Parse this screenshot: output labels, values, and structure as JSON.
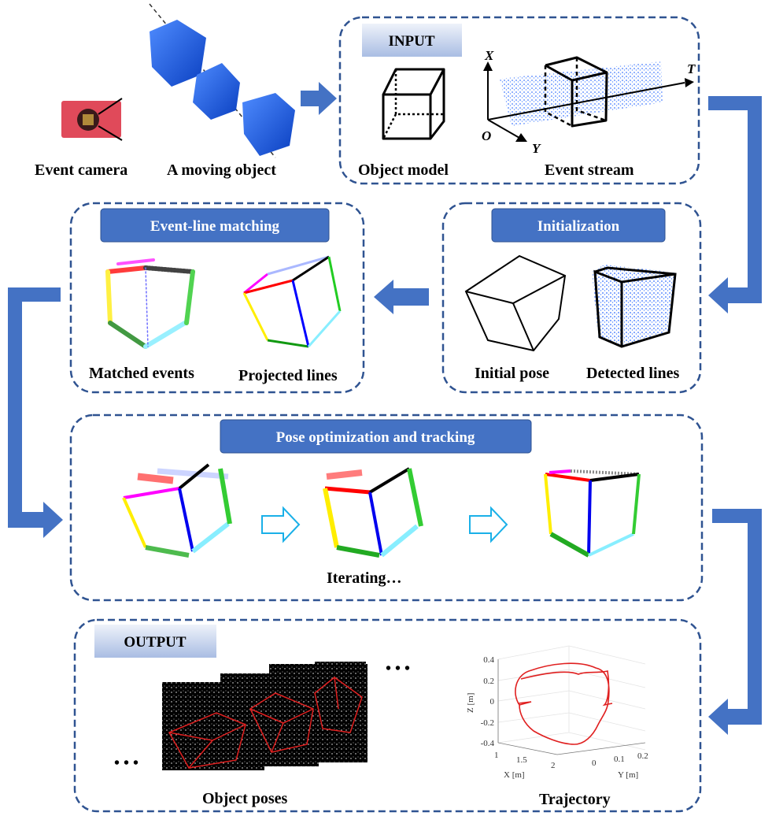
{
  "colors": {
    "accent": "#4472c4",
    "panel_border": "#2f5391",
    "trajectory": "#e02020"
  },
  "top": {
    "camera_label": "Event camera",
    "object_label": "A moving object"
  },
  "input": {
    "title": "INPUT",
    "model_label": "Object model",
    "stream_label": "Event stream",
    "axis_x": "X",
    "axis_y": "Y",
    "axis_t": "T",
    "origin": "O"
  },
  "matching": {
    "title": "Event-line matching",
    "matched_label": "Matched events",
    "projected_label": "Projected lines"
  },
  "init": {
    "title": "Initialization",
    "pose_label": "Initial pose",
    "lines_label": "Detected lines"
  },
  "optimization": {
    "title": "Pose optimization and tracking",
    "iter_label": "Iterating…"
  },
  "output": {
    "title": "OUTPUT",
    "poses_label": "Object poses",
    "trajectory_label": "Trajectory",
    "ellipsis": "• • •"
  },
  "chart_data": {
    "type": "line",
    "title": "",
    "xlabel": "X [m]",
    "ylabel": "Y [m]",
    "zlabel": "Z [m]",
    "x_ticks": [
      "1",
      "1.5",
      "2"
    ],
    "y_ticks": [
      "0",
      "0.1",
      "0.2"
    ],
    "z_ticks": [
      "0.4",
      "0.2",
      "0",
      "-0.2",
      "-0.4"
    ],
    "zlim": [
      -0.4,
      0.4
    ]
  }
}
